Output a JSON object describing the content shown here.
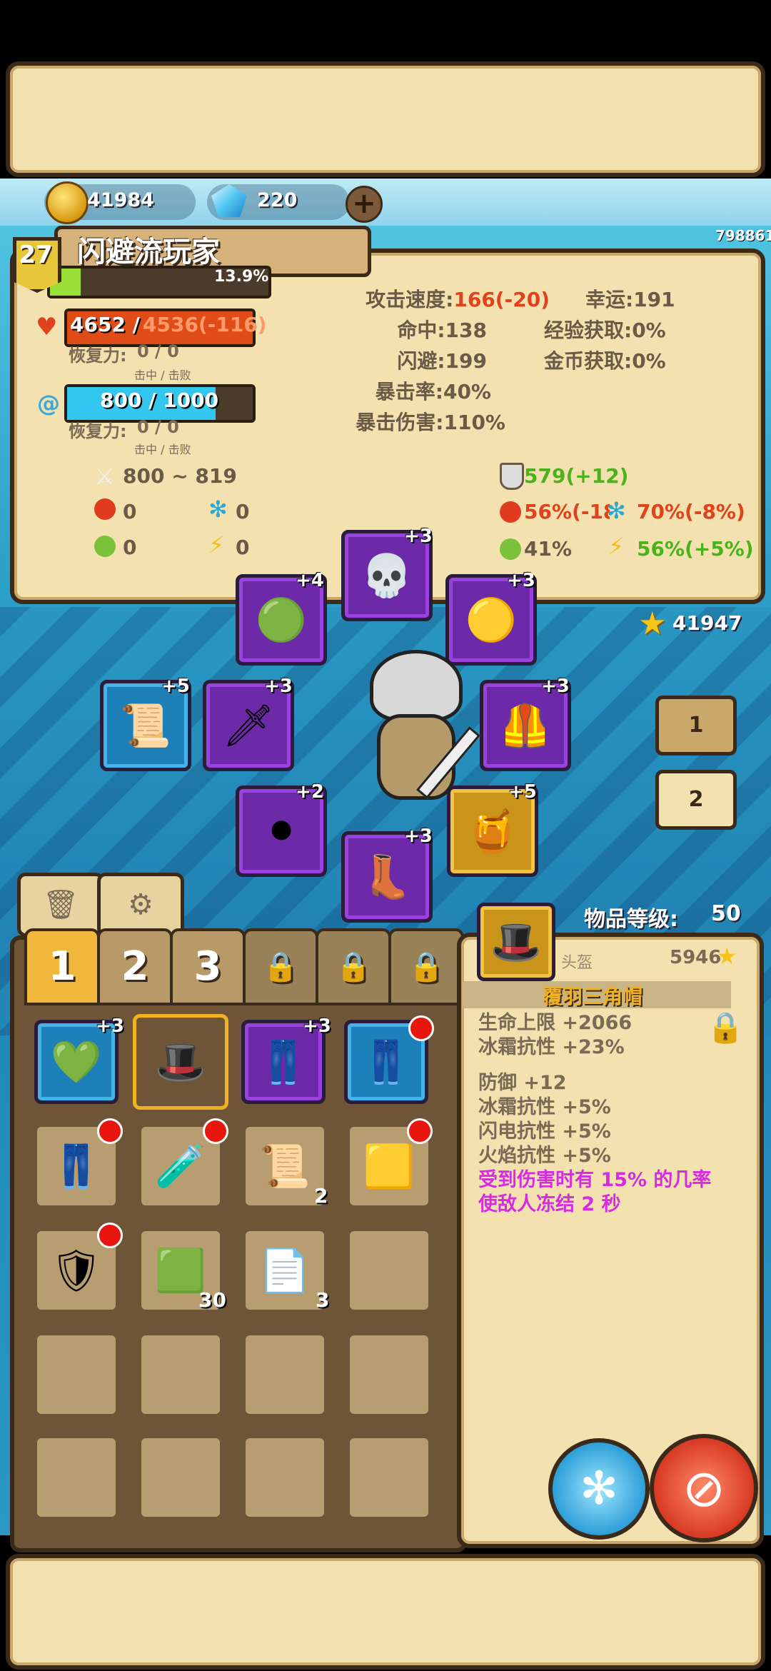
{
  "top_panel": {},
  "currency": {
    "gold": "41984",
    "gems": "220"
  },
  "player": {
    "level": "27",
    "name": "闪避流玩家",
    "exp_percent": "13.9%",
    "id_code": "798861",
    "hp": "4652 / ",
    "hp_max": "4536(-116)",
    "hp_regen_label": "恢复力:",
    "hp_regen": "0 / 0",
    "hp_regen_sub": "击中 / 击败",
    "mp": "800 / 1000",
    "mp_regen_label": "恢复力:",
    "mp_regen": "0 / 0",
    "mp_regen_sub": "击中 / 击败"
  },
  "stats_mid": [
    {
      "label": "攻击速度:",
      "value": "166(-20)"
    },
    {
      "label": "命中:",
      "value": "138"
    },
    {
      "label": "闪避:",
      "value": "199"
    },
    {
      "label": "暴击率:",
      "value": "40%"
    },
    {
      "label": "暴击伤害:",
      "value": "110%"
    }
  ],
  "stats_right": [
    {
      "label": "幸运:",
      "value": "191"
    },
    {
      "label": "经验获取:",
      "value": "0%"
    },
    {
      "label": "金币获取:",
      "value": "0%"
    }
  ],
  "attack": {
    "damage": "800 ~ 819",
    "fire": "0",
    "ice": "0",
    "poison": "0",
    "lightning": "0"
  },
  "defense": {
    "armor": "579(+12)",
    "fire_res": "56%(-18%)",
    "ice_res": "70%(-8%)",
    "poison_res": "41%",
    "lightning_res": "56%(+5%)"
  },
  "equipment": {
    "slots": [
      {
        "name": "helmet",
        "plus": "+3"
      },
      {
        "name": "amulet",
        "plus": "+4"
      },
      {
        "name": "ring",
        "plus": "+3"
      },
      {
        "name": "offhand",
        "plus": "+5"
      },
      {
        "name": "weapon",
        "plus": "+3"
      },
      {
        "name": "armor",
        "plus": "+3"
      },
      {
        "name": "belt",
        "plus": "+2"
      },
      {
        "name": "potion",
        "plus": "+5"
      },
      {
        "name": "boots",
        "plus": "+3"
      }
    ],
    "star_score": "41947",
    "set_buttons": [
      "1",
      "2"
    ]
  },
  "inventory": {
    "tabs": [
      "1",
      "2",
      "3"
    ],
    "item_level_label": "物品等级:",
    "item_level": "50",
    "items": [
      {
        "plus": "+3",
        "count": ""
      },
      {
        "plus": "",
        "count": ""
      },
      {
        "plus": "+3",
        "count": ""
      },
      {
        "plus": "",
        "count": ""
      },
      {
        "plus": "",
        "count": ""
      },
      {
        "plus": "",
        "count": ""
      },
      {
        "plus": "",
        "count": "2"
      },
      {
        "plus": "",
        "count": ""
      },
      {
        "plus": "",
        "count": ""
      },
      {
        "plus": "",
        "count": "30"
      },
      {
        "plus": "",
        "count": "3"
      }
    ]
  },
  "item_detail": {
    "type": "头盔",
    "score": "5946",
    "name": "覆羽三角帽",
    "base_stats": [
      "生命上限 +2066",
      "冰霜抗性 +23%"
    ],
    "affixes": [
      "防御 +12",
      "冰霜抗性 +5%",
      "闪电抗性 +5%",
      "火焰抗性 +5%"
    ],
    "special_1": "受到伤害时有 15% 的几率",
    "special_2": "使敌人冻结 2 秒"
  }
}
